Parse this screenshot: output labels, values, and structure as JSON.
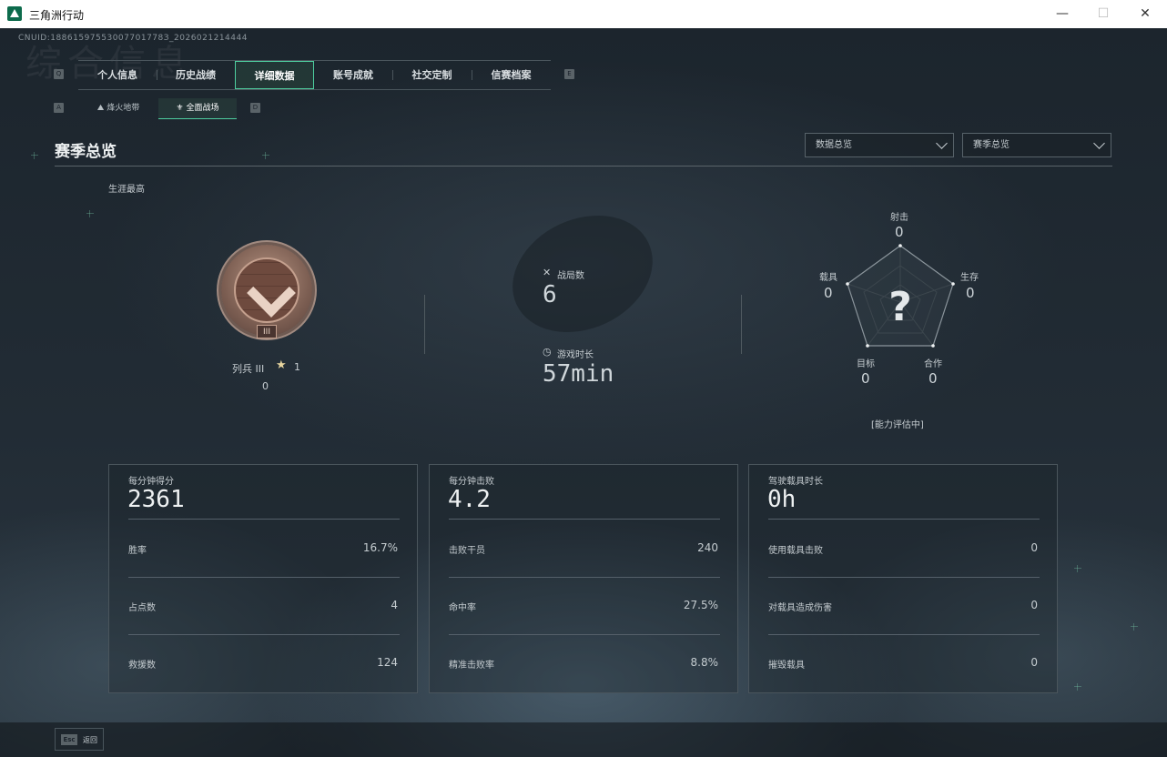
{
  "window": {
    "title": "三角洲行动",
    "minimize": "—",
    "maximize": "☐",
    "close": "✕"
  },
  "cnuid": "CNUID:18861597553007701778З_2026021214444",
  "bg_watermark": "综合信息",
  "tabs": {
    "left_key": "Q",
    "right_key": "E",
    "items": [
      {
        "label": "个人信息"
      },
      {
        "label": "历史战绩"
      },
      {
        "label": "详细数据"
      },
      {
        "label": "账号成就"
      },
      {
        "label": "社交定制"
      },
      {
        "label": "信赛档案"
      }
    ],
    "active_index": 2
  },
  "subtabs": {
    "left_key": "A",
    "right_key": "D",
    "items": [
      {
        "label": "烽火地带",
        "icon": "mountain-icon"
      },
      {
        "label": "全面战场",
        "icon": "wings-icon"
      }
    ],
    "active_index": 1
  },
  "section": {
    "title": "赛季总览",
    "dropdown_1": "数据总览",
    "dropdown_2": "赛季总览"
  },
  "career_label": "生涯最高",
  "rank": {
    "name": "列兵 III",
    "plate": "III",
    "stars": "1",
    "points": "0"
  },
  "match_stats": {
    "battles_label": "战局数",
    "battles_value": "6",
    "playtime_label": "游戏时长",
    "playtime_value": "57min"
  },
  "radar": {
    "center": "?",
    "status": "[能力评估中]",
    "axes": [
      {
        "label": "射击",
        "value": "0"
      },
      {
        "label": "生存",
        "value": "0"
      },
      {
        "label": "合作",
        "value": "0"
      },
      {
        "label": "目标",
        "value": "0"
      },
      {
        "label": "载具",
        "value": "0"
      }
    ]
  },
  "cards": [
    {
      "title": "每分钟得分",
      "big": "2361",
      "rows": [
        {
          "label": "胜率",
          "value": "16.7%"
        },
        {
          "label": "占点数",
          "value": "4"
        },
        {
          "label": "救援数",
          "value": "124"
        }
      ]
    },
    {
      "title": "每分钟击败",
      "big": "4.2",
      "rows": [
        {
          "label": "击败干员",
          "value": "240"
        },
        {
          "label": "命中率",
          "value": "27.5%"
        },
        {
          "label": "精准击败率",
          "value": "8.8%"
        }
      ]
    },
    {
      "title": "驾驶载具时长",
      "big": "0h",
      "rows": [
        {
          "label": "使用载具击败",
          "value": "0"
        },
        {
          "label": "对载具造成伤害",
          "value": "0"
        },
        {
          "label": "摧毁载具",
          "value": "0"
        }
      ]
    }
  ],
  "footer": {
    "esc_key": "Esc",
    "back_label": "返回"
  },
  "colors": {
    "accent": "#4ecfa0",
    "background": "#1b232b"
  }
}
